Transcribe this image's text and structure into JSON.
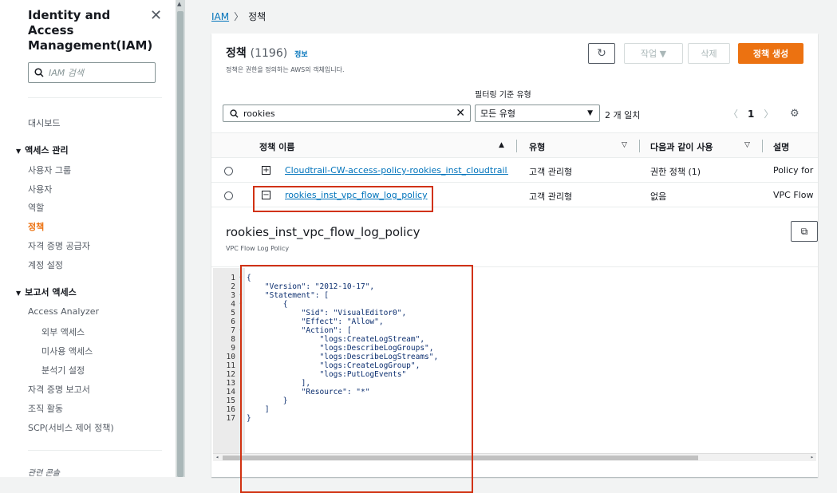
{
  "sidebar": {
    "title": "Identity and Access Management(IAM)",
    "search_placeholder": "IAM 검색",
    "dashboard": "대시보드",
    "access_mgmt_heading": "액세스 관리",
    "user_groups": "사용자 그룹",
    "users": "사용자",
    "roles": "역할",
    "policies": "정책",
    "identity_providers": "자격 증명 공급자",
    "account_settings": "계정 설정",
    "reports_heading": "보고서 액세스",
    "access_analyzer": "Access Analyzer",
    "external_access": "외부 액세스",
    "unused_access": "미사용 액세스",
    "analyzer_settings": "분석기 설정",
    "credential_report": "자격 증명 보고서",
    "org_activity": "조직 활동",
    "scp": "SCP(서비스 제어 정책)",
    "related_consoles": "관련 콘솔"
  },
  "breadcrumb": {
    "root": "IAM",
    "current": "정책"
  },
  "header": {
    "title": "정책",
    "count": "(1196)",
    "info": "정보",
    "description": "정책은 권한을 정의하는 AWS의 객체입니다.",
    "action_label": "작업 ▼",
    "delete_label": "삭제",
    "create_label": "정책 생성"
  },
  "filter": {
    "type_label": "필터링 기준 유형",
    "search_value": "rookies",
    "type_value": "모든 유형",
    "match_text": "2 개 일치",
    "page": "1"
  },
  "table": {
    "col_name": "정책 이름",
    "col_type": "유형",
    "col_used_as": "다음과 같이 사용",
    "col_desc": "설명",
    "rows": [
      {
        "name": "Cloudtrail-CW-access-policy-rookies_inst_cloudtrail...",
        "type": "고객 관리형",
        "used_as": "권한 정책 (1)",
        "desc": "Policy for"
      },
      {
        "name": "rookies_inst_vpc_flow_log_policy",
        "type": "고객 관리형",
        "used_as": "없음",
        "desc": "VPC Flow"
      }
    ]
  },
  "detail": {
    "title": "rookies_inst_vpc_flow_log_policy",
    "subtitle": "VPC Flow Log Policy"
  },
  "code": {
    "lines": [
      "{",
      "    \"Version\": \"2012-10-17\",",
      "    \"Statement\": [",
      "        {",
      "            \"Sid\": \"VisualEditor0\",",
      "            \"Effect\": \"Allow\",",
      "            \"Action\": [",
      "                \"logs:CreateLogStream\",",
      "                \"logs:DescribeLogGroups\",",
      "                \"logs:DescribeLogStreams\",",
      "                \"logs:CreateLogGroup\",",
      "                \"logs:PutLogEvents\"",
      "            ],",
      "            \"Resource\": \"*\"",
      "        }",
      "    ]",
      "}"
    ],
    "fold_lines": [
      1,
      3,
      4,
      7
    ]
  },
  "colors": {
    "accent": "#ec7211",
    "link": "#0073bb",
    "highlight": "#d13212"
  }
}
